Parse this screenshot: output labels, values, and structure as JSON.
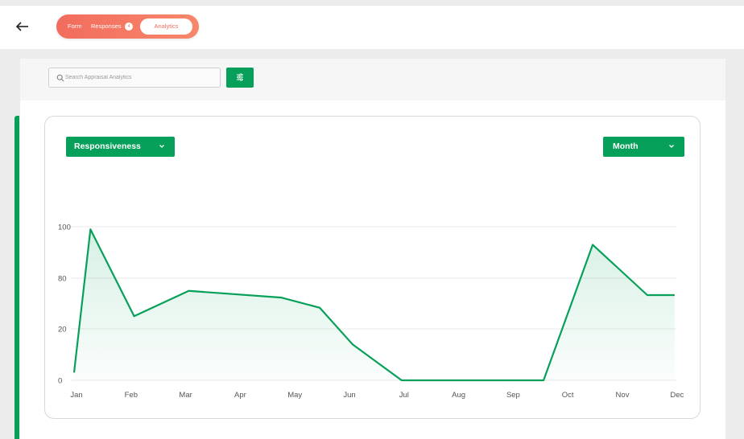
{
  "header": {
    "back_icon": "arrow-left-icon",
    "tabs": [
      {
        "label": "Form"
      },
      {
        "label": "Responses",
        "badge": "4"
      },
      {
        "label": "Analytics",
        "active": true
      }
    ]
  },
  "search": {
    "placeholder": "Search Appraisal Analytics",
    "filter_icon": "sliders-icon"
  },
  "chart_controls": {
    "metric": "Responsiveness",
    "period": "Month"
  },
  "colors": {
    "brand_green": "#07a05a",
    "tab_gradient_start": "#f26c5e",
    "tab_gradient_end": "#f7876a"
  },
  "chart_data": {
    "type": "area",
    "categories": [
      "Jan",
      "Feb",
      "Mar",
      "Apr",
      "May",
      "Jun",
      "Jul",
      "Aug",
      "Sep",
      "Oct",
      "Nov",
      "Dec"
    ],
    "y_ticks": [
      "0",
      "20",
      "80",
      "100"
    ],
    "series": [
      {
        "x": [
          0,
          0.3,
          1.1,
          2.1,
          3.8,
          4.5,
          5.1,
          6,
          7,
          8,
          8.5,
          8.6,
          9.5,
          10.5,
          11
        ],
        "values": [
          3,
          99,
          35,
          65,
          57,
          45,
          14,
          0,
          0,
          0,
          0,
          0,
          93,
          60,
          60
        ]
      }
    ],
    "grid": true,
    "legend": "none",
    "title": "",
    "xlabel": "",
    "ylabel": ""
  }
}
